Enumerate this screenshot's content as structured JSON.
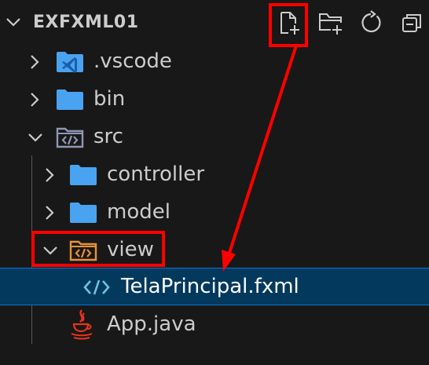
{
  "explorer": {
    "title": "EXFXML01",
    "toolbar": {
      "new_file_icon": "new-file-icon",
      "new_folder_icon": "new-folder-icon",
      "refresh_icon": "refresh-icon",
      "collapse_all_icon": "collapse-all-icon"
    },
    "tree": [
      {
        "label": ".vscode",
        "icon": "vscode-folder-icon",
        "expanded": false
      },
      {
        "label": "bin",
        "icon": "folder-icon",
        "expanded": false
      },
      {
        "label": "src",
        "icon": "source-folder-icon",
        "expanded": true
      },
      {
        "label": "controller",
        "icon": "folder-icon",
        "expanded": false
      },
      {
        "label": "model",
        "icon": "folder-icon",
        "expanded": false
      },
      {
        "label": "view",
        "icon": "view-folder-icon",
        "expanded": true
      },
      {
        "label": "TelaPrincipal.fxml",
        "icon": "fxml-file-icon",
        "selected": true
      },
      {
        "label": "App.java",
        "icon": "java-icon"
      }
    ]
  },
  "colors": {
    "background": "#181818",
    "text": "#cccccc",
    "selection": "#04395e",
    "selection_border": "#0078d4",
    "folder_blue": "#4aa3f0",
    "annotation_red": "#ff0000"
  }
}
